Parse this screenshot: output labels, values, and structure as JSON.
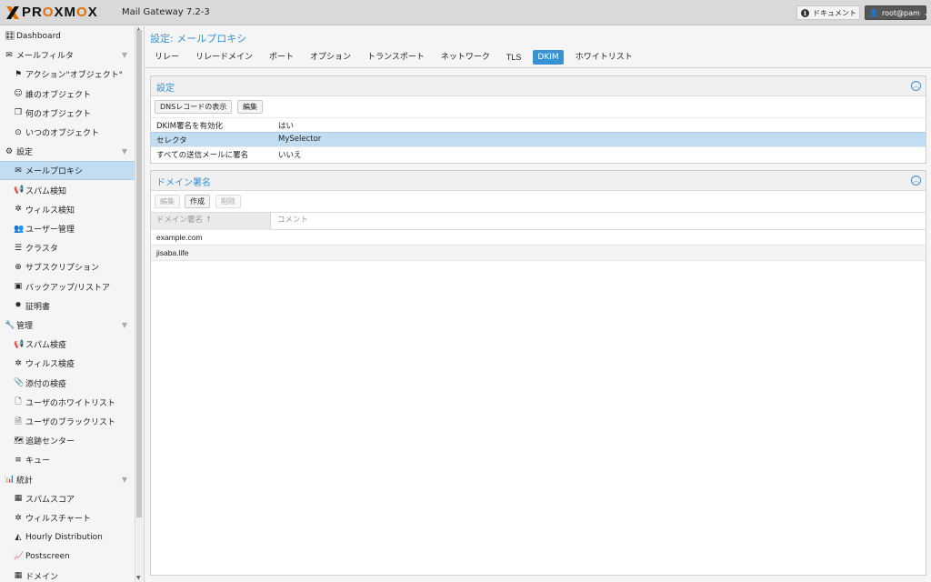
{
  "header": {
    "brand": "PROXMOX",
    "product": "Mail Gateway 7.2-3",
    "docs_label": "ドキュメント",
    "user_label": "root@pam"
  },
  "sidebar": {
    "items": [
      {
        "label": "Dashboard",
        "icon": "dashboard-icon",
        "glyph": "🎛",
        "level": "group"
      },
      {
        "label": "メールフィルタ",
        "icon": "envelope-icon",
        "glyph": "✉",
        "level": "group",
        "expandable": true
      },
      {
        "label": "アクション\"オブジェクト\"",
        "icon": "flag-icon",
        "glyph": "⚑",
        "level": "child"
      },
      {
        "label": "誰のオブジェクト",
        "icon": "user-circle-icon",
        "glyph": "☺",
        "level": "child"
      },
      {
        "label": "何のオブジェクト",
        "icon": "cube-icon",
        "glyph": "❒",
        "level": "child"
      },
      {
        "label": "いつのオブジェクト",
        "icon": "clock-icon",
        "glyph": "⊙",
        "level": "child"
      },
      {
        "label": "設定",
        "icon": "gears-icon",
        "glyph": "⚙",
        "level": "group",
        "expandable": true
      },
      {
        "label": "メールプロキシ",
        "icon": "envelope-outline-icon",
        "glyph": "✉",
        "level": "child",
        "selected": true
      },
      {
        "label": "スパム検知",
        "icon": "bullhorn-icon",
        "glyph": "📢",
        "level": "child"
      },
      {
        "label": "ウィルス検知",
        "icon": "bug-icon",
        "glyph": "✲",
        "level": "child"
      },
      {
        "label": "ユーザー管理",
        "icon": "users-icon",
        "glyph": "👥",
        "level": "child"
      },
      {
        "label": "クラスタ",
        "icon": "server-icon",
        "glyph": "☰",
        "level": "child"
      },
      {
        "label": "サブスクリプション",
        "icon": "support-icon",
        "glyph": "⊕",
        "level": "child"
      },
      {
        "label": "バックアップ/リストア",
        "icon": "floppy-icon",
        "glyph": "▣",
        "level": "child"
      },
      {
        "label": "証明書",
        "icon": "certificate-icon",
        "glyph": "✹",
        "level": "child"
      },
      {
        "label": "管理",
        "icon": "wrench-icon",
        "glyph": "🔧",
        "level": "group",
        "expandable": true
      },
      {
        "label": "スパム検疫",
        "icon": "bullhorn-icon",
        "glyph": "📢",
        "level": "child"
      },
      {
        "label": "ウィルス検疫",
        "icon": "bug-icon",
        "glyph": "✲",
        "level": "child"
      },
      {
        "label": "添付の検疫",
        "icon": "paperclip-icon",
        "glyph": "📎",
        "level": "child"
      },
      {
        "label": "ユーザのホワイトリスト",
        "icon": "file-outline-icon",
        "glyph": "🗋",
        "level": "child"
      },
      {
        "label": "ユーザのブラックリスト",
        "icon": "file-icon",
        "glyph": "🗎",
        "level": "child"
      },
      {
        "label": "追跡センター",
        "icon": "map-icon",
        "glyph": "🗺",
        "level": "child"
      },
      {
        "label": "キュー",
        "icon": "bars-icon",
        "glyph": "≡",
        "level": "child"
      },
      {
        "label": "統計",
        "icon": "bar-chart-icon",
        "glyph": "📊",
        "level": "group",
        "expandable": true
      },
      {
        "label": "スパムスコア",
        "icon": "table-icon",
        "glyph": "▦",
        "level": "child"
      },
      {
        "label": "ウィルスチャート",
        "icon": "bug-icon",
        "glyph": "✲",
        "level": "child"
      },
      {
        "label": "Hourly Distribution",
        "icon": "area-chart-icon",
        "glyph": "◭",
        "level": "child"
      },
      {
        "label": "Postscreen",
        "icon": "line-chart-icon",
        "glyph": "📈",
        "level": "child"
      },
      {
        "label": "ドメイン",
        "icon": "table-icon",
        "glyph": "▦",
        "level": "child"
      }
    ]
  },
  "main": {
    "title": "設定: メールプロキシ",
    "tabs": [
      "リレー",
      "リレードメイン",
      "ポート",
      "オプション",
      "トランスポート",
      "ネットワーク",
      "TLS",
      "DKIM",
      "ホワイトリスト"
    ],
    "active_tab": "DKIM",
    "settings_panel": {
      "title": "設定",
      "buttons": {
        "show_dns": "DNSレコードの表示",
        "edit": "編集"
      },
      "rows": [
        {
          "key": "DKIM署名を有効化",
          "value": "はい",
          "selected": false
        },
        {
          "key": "セレクタ",
          "value": "MySelector",
          "selected": true
        },
        {
          "key": "すべての送信メールに署名",
          "value": "いいえ",
          "selected": false
        }
      ]
    },
    "domain_panel": {
      "title": "ドメイン署名",
      "buttons": {
        "edit": "編集",
        "create": "作成",
        "delete": "削除"
      },
      "columns": {
        "domain": "ドメイン署名 ↑",
        "comment": "コメント"
      },
      "rows": [
        "example.com",
        "jisaba.life"
      ]
    }
  }
}
